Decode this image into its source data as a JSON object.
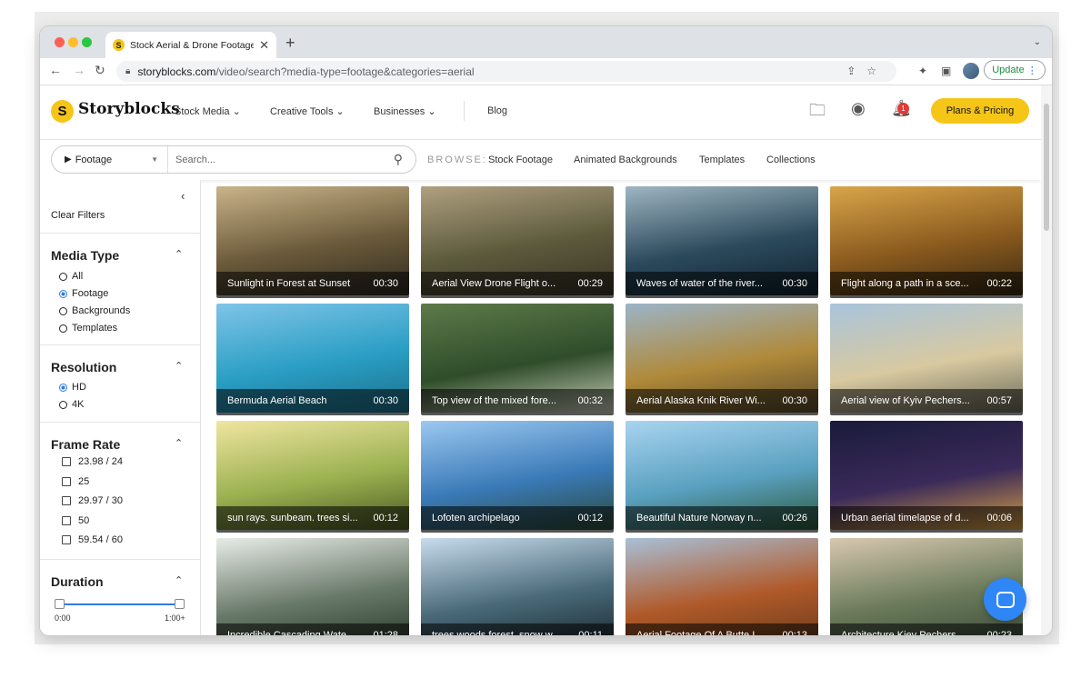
{
  "browser": {
    "tab_title": "Stock Aerial & Drone Footage",
    "favicon": "S",
    "url_host": "storyblocks.com",
    "url_path": "/video/search?media-type=footage&categories=aerial",
    "update_label": "Update"
  },
  "header": {
    "logo_mark": "S",
    "logo_text": "Storyblocks",
    "nav": [
      "Stock Media",
      "Creative Tools",
      "Businesses"
    ],
    "blog": "Blog",
    "notification_count": "1",
    "pricing_label": "Plans & Pricing"
  },
  "search": {
    "type_label": "Footage",
    "placeholder": "Search...",
    "browse_label": "BROWSE:",
    "browse_links": [
      "Stock Footage",
      "Animated Backgrounds",
      "Templates",
      "Collections"
    ]
  },
  "sidebar": {
    "clear_filters": "Clear Filters",
    "media_type": {
      "title": "Media Type",
      "options": [
        "All",
        "Footage",
        "Backgrounds",
        "Templates"
      ],
      "selected": "Footage"
    },
    "resolution": {
      "title": "Resolution",
      "options": [
        "HD",
        "4K"
      ],
      "selected": "HD"
    },
    "frame_rate": {
      "title": "Frame Rate",
      "options": [
        "23.98 / 24",
        "25",
        "29.97 / 30",
        "50",
        "59.54 / 60"
      ]
    },
    "duration": {
      "title": "Duration",
      "min_label": "0:00",
      "max_label": "1:00+"
    }
  },
  "videos": [
    {
      "title": "Sunlight in Forest at Sunset",
      "duration": "00:30",
      "colors": [
        "#c9b48a",
        "#6b5a3a",
        "#2e2a20"
      ]
    },
    {
      "title": "Aerial View Drone Flight o...",
      "duration": "00:29",
      "colors": [
        "#b0a080",
        "#5c5a3c",
        "#3a3426"
      ]
    },
    {
      "title": "Waves of water of the river...",
      "duration": "00:30",
      "colors": [
        "#9fb6c2",
        "#2c4a5c",
        "#0f2230"
      ]
    },
    {
      "title": "Flight along a path in a sce...",
      "duration": "00:22",
      "colors": [
        "#d9a54a",
        "#8a5a1e",
        "#3a2a12"
      ]
    },
    {
      "title": "Bermuda Aerial Beach",
      "duration": "00:30",
      "colors": [
        "#7fc4e8",
        "#2a9ec4",
        "#1c6f8a"
      ]
    },
    {
      "title": "Top view of the mixed fore...",
      "duration": "00:32",
      "colors": [
        "#5d7a4a",
        "#2f4d2a",
        "#c9ccb8"
      ]
    },
    {
      "title": "Aerial Alaska Knik River Wi...",
      "duration": "00:30",
      "colors": [
        "#9bb4c8",
        "#b08a3a",
        "#5c4a2a"
      ]
    },
    {
      "title": "Aerial view of Kyiv Pechers...",
      "duration": "00:57",
      "colors": [
        "#a8c4dc",
        "#d8c9a0",
        "#6a6a5a"
      ]
    },
    {
      "title": "sun rays. sunbeam. trees si...",
      "duration": "00:12",
      "colors": [
        "#f0e6a0",
        "#9ab050",
        "#4a5a22"
      ]
    },
    {
      "title": "Lofoten archipelago",
      "duration": "00:12",
      "colors": [
        "#9cc8f0",
        "#3a7ab8",
        "#2a4a3a"
      ]
    },
    {
      "title": "Beautiful Nature Norway n...",
      "duration": "00:26",
      "colors": [
        "#a8d4f0",
        "#5aa0c0",
        "#2a5a3a"
      ]
    },
    {
      "title": "Urban aerial timelapse of d...",
      "duration": "00:06",
      "colors": [
        "#1a1a3a",
        "#3a2a5a",
        "#d8a040"
      ]
    },
    {
      "title": "Incredible Cascading Wate...",
      "duration": "01:28",
      "colors": [
        "#e8ece8",
        "#6a7a6a",
        "#2a3a2a"
      ]
    },
    {
      "title": "trees woods forest. snow w...",
      "duration": "00:11",
      "colors": [
        "#c8dcec",
        "#4a6a7a",
        "#1a2a30"
      ]
    },
    {
      "title": "Aerial Footage Of A Butte I...",
      "duration": "00:13",
      "colors": [
        "#a8c0d8",
        "#b05a2a",
        "#6a3a1a"
      ]
    },
    {
      "title": "Architecture Kiev Pechers...",
      "duration": "00:23",
      "colors": [
        "#d8c8b0",
        "#6a7a5a",
        "#3a4a3a"
      ]
    }
  ]
}
